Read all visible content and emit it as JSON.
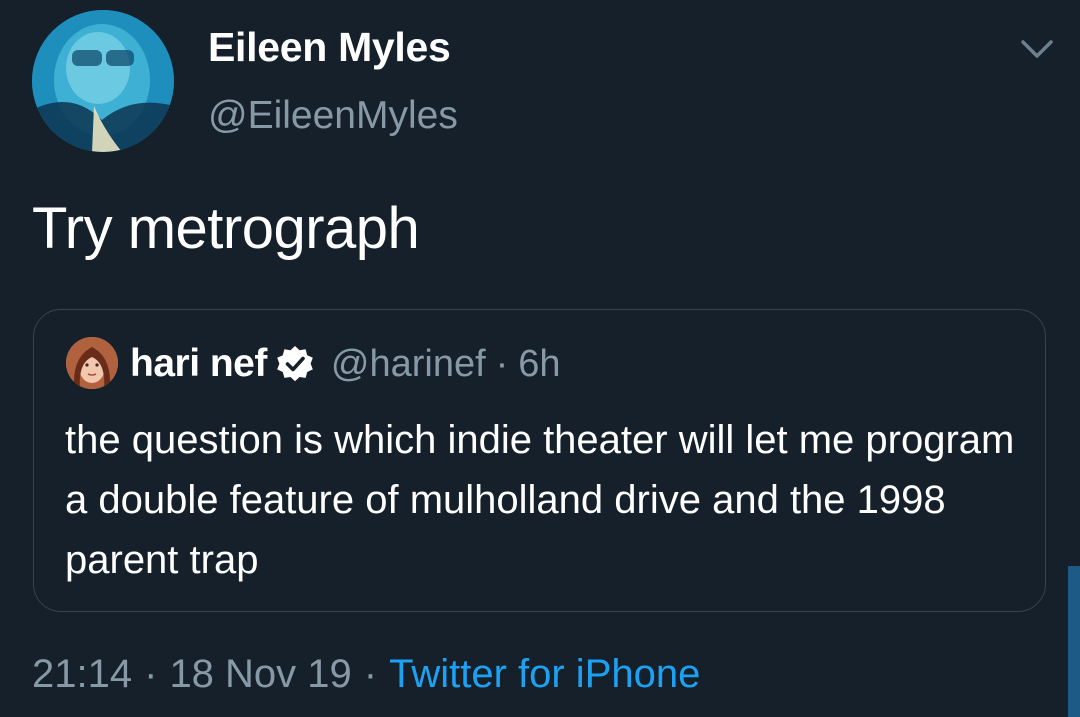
{
  "author": {
    "display_name": "Eileen Myles",
    "handle": "@EileenMyles",
    "avatar_icon": "profile-photo"
  },
  "tweet": {
    "text": "Try metrograph"
  },
  "quoted_tweet": {
    "display_name": "hari nef",
    "verified": true,
    "handle": "@harinef",
    "separator": "·",
    "time": "6h",
    "text": "the question is which indie theater will let me program a double feature of mulholland drive and the 1998 parent trap"
  },
  "meta": {
    "time": "21:14",
    "separator": "·",
    "date": "18 Nov 19",
    "source": "Twitter for iPhone"
  },
  "colors": {
    "background": "#15202b",
    "secondary_text": "#8899a6",
    "accent": "#1da1f2",
    "border": "#38444d"
  },
  "icons": {
    "menu": "chevron-down-icon",
    "verified": "verified-badge-icon"
  }
}
